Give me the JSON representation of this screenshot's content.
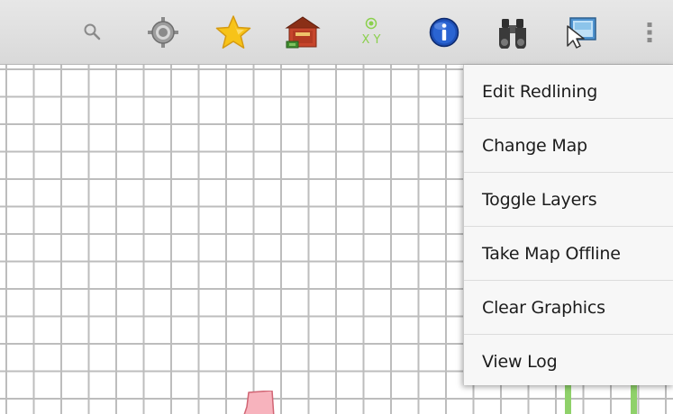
{
  "toolbar": {
    "icons": [
      {
        "name": "search-icon"
      },
      {
        "name": "gps-locate-icon"
      },
      {
        "name": "favorite-star-icon"
      },
      {
        "name": "home-building-icon"
      },
      {
        "name": "xy-coordinates-icon",
        "label": "X Y"
      },
      {
        "name": "info-icon"
      },
      {
        "name": "binoculars-icon"
      },
      {
        "name": "select-pointer-icon"
      },
      {
        "name": "overflow-menu-icon"
      }
    ]
  },
  "overflow_menu": {
    "items": [
      {
        "label": "Edit Redlining"
      },
      {
        "label": "Change Map"
      },
      {
        "label": "Toggle Layers"
      },
      {
        "label": "Take Map Offline"
      },
      {
        "label": "Clear Graphics"
      },
      {
        "label": "View Log"
      }
    ]
  },
  "colors": {
    "action_bar": "#dedede",
    "grid_lines": "#bdbdbd",
    "menu_bg": "#f7f7f7",
    "info_blue": "#1e4fb5",
    "star_yellow": "#f7c318",
    "green_feature": "#8fd16a",
    "pink_feature": "#f7b3bd"
  }
}
